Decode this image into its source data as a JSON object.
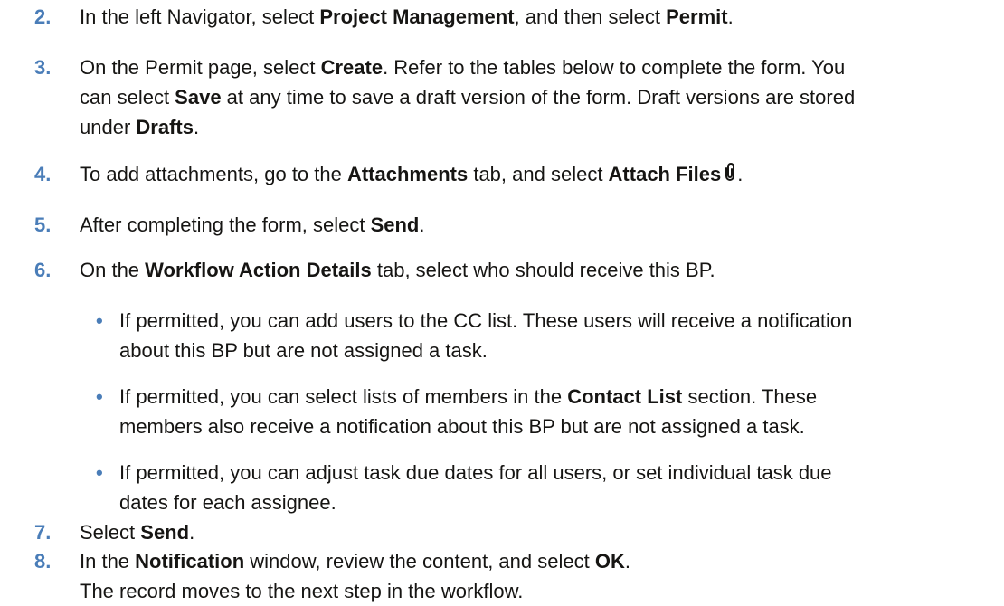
{
  "accent_color": "#4a7db8",
  "steps": [
    {
      "number": "2.",
      "parts": [
        {
          "t": "In the left Navigator, select "
        },
        {
          "b": "Project Management"
        },
        {
          "t": ", and then select "
        },
        {
          "b": "Permit"
        },
        {
          "t": "."
        }
      ]
    },
    {
      "number": "3.",
      "line1": [
        {
          "t": "On the Permit page, select "
        },
        {
          "b": "Create"
        },
        {
          "t": ". Refer to the tables below to complete the form. You"
        }
      ],
      "line2": [
        {
          "t": "can select "
        },
        {
          "b": "Save"
        },
        {
          "t": " at any time to save a draft version of the form. Draft versions are stored"
        }
      ],
      "line3": [
        {
          "t": "under "
        },
        {
          "b": "Drafts"
        },
        {
          "t": "."
        }
      ]
    },
    {
      "number": "4.",
      "parts": [
        {
          "t": "To add attachments, go to the "
        },
        {
          "b": "Attachments"
        },
        {
          "t": " tab, and select "
        },
        {
          "b": "Attach Files"
        }
      ],
      "icon": "paperclip-icon",
      "tail": "."
    },
    {
      "number": "5.",
      "parts": [
        {
          "t": "After completing the form, select "
        },
        {
          "b": "Send"
        },
        {
          "t": "."
        }
      ]
    },
    {
      "number": "6.",
      "parts": [
        {
          "t": "On the "
        },
        {
          "b": "Workflow Action Details"
        },
        {
          "t": " tab, select who should receive this BP."
        }
      ],
      "bullets": [
        {
          "line1": [
            {
              "t": "If permitted, you can add users to the CC list. These users will receive a notification"
            }
          ],
          "line2": [
            {
              "t": "about this BP but are not assigned a task."
            }
          ]
        },
        {
          "line1": [
            {
              "t": "If permitted, you can select lists of members in the "
            },
            {
              "b": "Contact List"
            },
            {
              "t": " section. These"
            }
          ],
          "line2": [
            {
              "t": "members also receive a notification about this BP but are not assigned a task."
            }
          ]
        },
        {
          "line1": [
            {
              "t": "If permitted, you can adjust task due dates for all users, or set individual task due"
            }
          ],
          "line2": [
            {
              "t": "dates for each assignee."
            }
          ]
        }
      ]
    },
    {
      "number": "7.",
      "parts": [
        {
          "t": "Select "
        },
        {
          "b": "Send"
        },
        {
          "t": "."
        }
      ]
    },
    {
      "number": "8.",
      "line1": [
        {
          "t": "In the "
        },
        {
          "b": "Notification"
        },
        {
          "t": " window, review the content, and select "
        },
        {
          "b": "OK"
        },
        {
          "t": "."
        }
      ],
      "line2": [
        {
          "t": "The record moves to the next step in the workflow."
        }
      ]
    }
  ],
  "bullet_char": "•"
}
